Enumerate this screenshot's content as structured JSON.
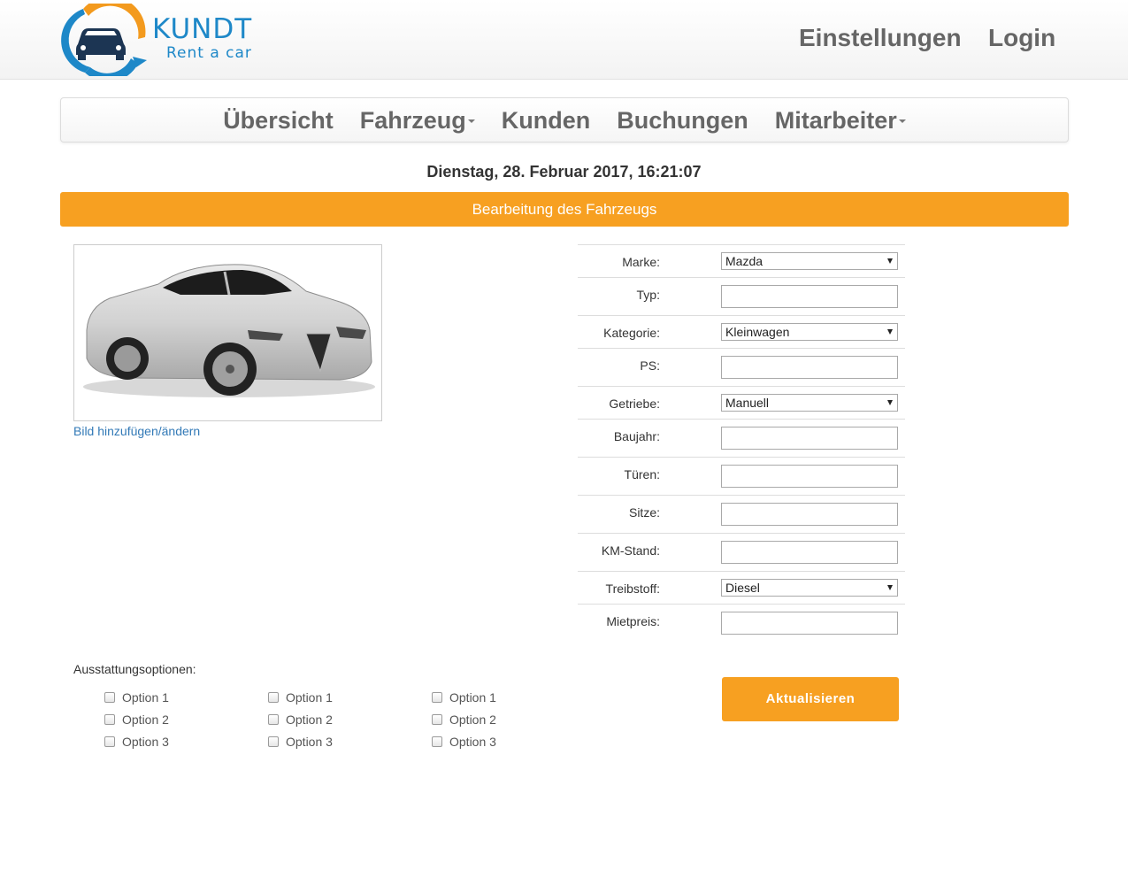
{
  "header": {
    "logo_brand": "KUNDT",
    "logo_tagline": "Rent a car",
    "settings_label": "Einstellungen",
    "login_label": "Login"
  },
  "nav": {
    "items": [
      {
        "label": "Übersicht",
        "dropdown": false
      },
      {
        "label": "Fahrzeug",
        "dropdown": true
      },
      {
        "label": "Kunden",
        "dropdown": false
      },
      {
        "label": "Buchungen",
        "dropdown": false
      },
      {
        "label": "Mitarbeiter",
        "dropdown": true
      }
    ]
  },
  "datetime": "Dienstag, 28. Februar 2017, 16:21:07",
  "page_title": "Bearbeitung des Fahrzeugs",
  "image": {
    "link_label": "Bild hinzufügen/ändern"
  },
  "form": {
    "fields": [
      {
        "label": "Marke:",
        "type": "select",
        "value": "Mazda"
      },
      {
        "label": "Typ:",
        "type": "input",
        "value": ""
      },
      {
        "label": "Kategorie:",
        "type": "select",
        "value": "Kleinwagen"
      },
      {
        "label": "PS:",
        "type": "input",
        "value": ""
      },
      {
        "label": "Getriebe:",
        "type": "select",
        "value": "Manuell"
      },
      {
        "label": "Baujahr:",
        "type": "input",
        "value": ""
      },
      {
        "label": "Türen:",
        "type": "input",
        "value": ""
      },
      {
        "label": "Sitze:",
        "type": "input",
        "value": ""
      },
      {
        "label": "KM-Stand:",
        "type": "input",
        "value": ""
      },
      {
        "label": "Treibstoff:",
        "type": "select",
        "value": "Diesel"
      },
      {
        "label": "Mietpreis:",
        "type": "input",
        "value": ""
      }
    ]
  },
  "options": {
    "label": "Ausstattungsoptionen:",
    "columns": [
      [
        "Option 1",
        "Option 2",
        "Option 3"
      ],
      [
        "Option 1",
        "Option 2",
        "Option 3"
      ],
      [
        "Option 1",
        "Option 2",
        "Option 3"
      ]
    ]
  },
  "submit_label": "Aktualisieren",
  "colors": {
    "accent": "#f7a021",
    "logo_blue": "#1e88c8",
    "link": "#337ab7"
  }
}
